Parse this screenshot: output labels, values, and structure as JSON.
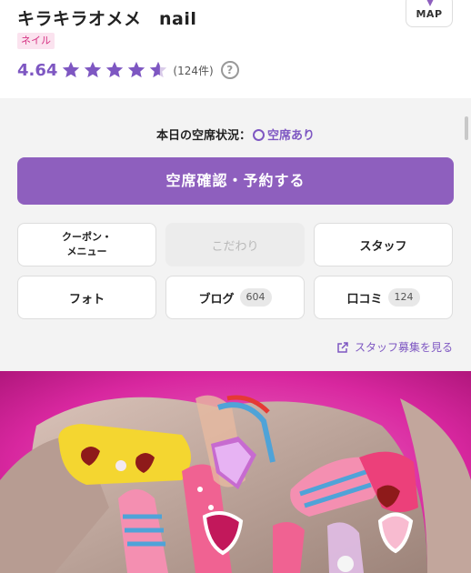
{
  "shop": {
    "name": "キラキラオメメ　nail",
    "genre": "ネイル",
    "rating": "4.64",
    "rating_stars": 4.64,
    "review_count": "(124件)",
    "help_symbol": "?"
  },
  "map_button": {
    "label": "MAP",
    "icon": "map-pin-icon"
  },
  "availability": {
    "prefix": "本日の空席状況：",
    "status": "空席あり"
  },
  "reserve_button": {
    "label": "空席確認・予約する"
  },
  "menu_buttons": [
    {
      "label_line1": "クーポン・",
      "label_line2": "メニュー"
    },
    {
      "label": "こだわり",
      "disabled": true
    },
    {
      "label": "スタッフ"
    },
    {
      "label": "フォト"
    },
    {
      "label": "ブログ",
      "count": "604"
    },
    {
      "label": "口コミ",
      "count": "124"
    }
  ],
  "staff_recruit_link": {
    "label": "スタッフ募集を見る",
    "icon": "external-link-icon"
  },
  "photo": {
    "subject": "nail-art-photo"
  },
  "colors": {
    "accent": "#8e5fbe",
    "star": "#7e57c2",
    "badge_bg": "#fbe3ef",
    "badge_text": "#d63384"
  }
}
